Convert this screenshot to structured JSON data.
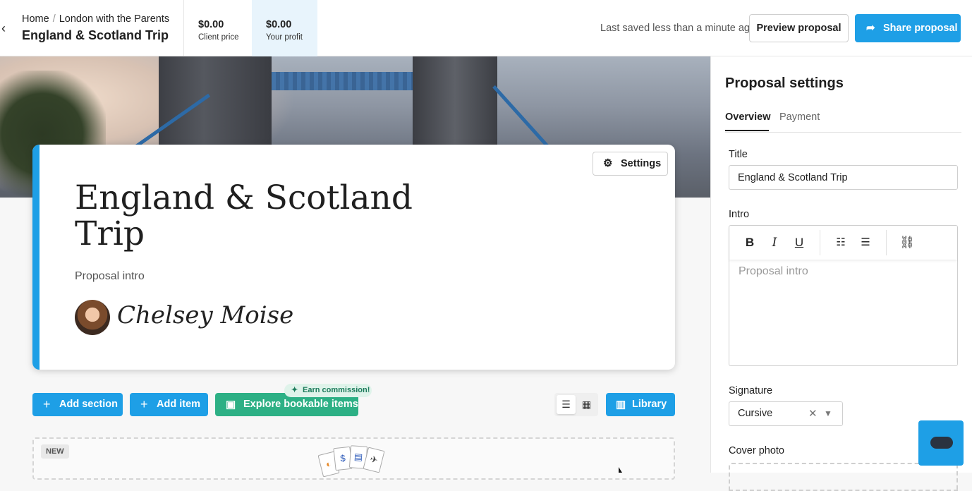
{
  "header": {
    "breadcrumb": {
      "home": "Home",
      "separator": "/",
      "current": "London with the Parents"
    },
    "trip_title": "England & Scotland Trip",
    "client_price": {
      "amount": "$0.00",
      "label": "Client price"
    },
    "your_profit": {
      "amount": "$0.00",
      "label": "Your profit"
    },
    "saved_status": "Last saved less than a minute ago",
    "preview_label": "Preview proposal",
    "share_label": "Share proposal"
  },
  "cover": {
    "settings_label": "Settings",
    "title": "England & Scotland Trip",
    "intro": "Proposal intro",
    "signature": "Chelsey Moise"
  },
  "actions": {
    "add_section": "Add section",
    "add_item": "Add item",
    "explore": "Explore bookable items",
    "earn_badge": "Earn commission!",
    "library": "Library"
  },
  "new_block": {
    "tag": "NEW"
  },
  "panel": {
    "title": "Proposal settings",
    "tabs": [
      "Overview",
      "Payment"
    ],
    "title_label": "Title",
    "title_value": "England & Scotland Trip",
    "intro_label": "Intro",
    "intro_placeholder": "Proposal intro",
    "signature_label": "Signature",
    "signature_value": "Cursive",
    "cover_photo_label": "Cover photo"
  },
  "colors": {
    "accent": "#1e9fe6",
    "green": "#2db085",
    "profit_bg": "#e8f4fc"
  }
}
